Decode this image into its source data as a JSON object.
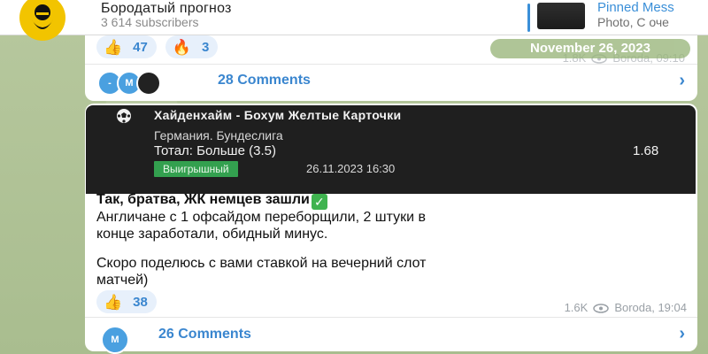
{
  "header": {
    "title": "Бородатый прогноз",
    "subscribers": "3 614 subscribers",
    "pinned_label": "Pinned Mess",
    "pinned_preview": "Photo, С оче"
  },
  "top_post": {
    "reactions": [
      {
        "emoji": "👍",
        "count": "47"
      },
      {
        "emoji": "🔥",
        "count": "3"
      }
    ],
    "views": "1.8K",
    "author_time": "Boroda, 09:10",
    "comments_label": "28 Comments",
    "commenter_initials": [
      "-",
      "M"
    ]
  },
  "date_separator": "November 26, 2023",
  "main_post": {
    "card": {
      "match": "Хайденхайм - Бохум Желтые Карточки",
      "league": "Германия. Бундеслига",
      "bet": "Тотал: Больше (3.5)",
      "odds": "1.68",
      "status": "Выигрышный",
      "datetime": "26.11.2023 16:30"
    },
    "headline": "Так, братва, ЖК немцев зашли",
    "body_line1": "Англичане с 1 офсайдом переборщили, 2 штуки в",
    "body_line2": "конце заработали, обидный минус.",
    "body_line3": "Скоро поделюсь с вами ставкой на вечерний слот",
    "body_line4": "матчей)",
    "reactions": [
      {
        "emoji": "👍",
        "count": "38"
      }
    ],
    "views": "1.6K",
    "author_time": "Boroda, 19:04",
    "comments_label": "26 Comments",
    "commenter_initials": [
      "M"
    ]
  },
  "colors": {
    "accent": "#3a86cf",
    "badge_green": "#33a04f",
    "card_bg": "#1f1f1f",
    "avatar_yellow": "#f2c400"
  }
}
